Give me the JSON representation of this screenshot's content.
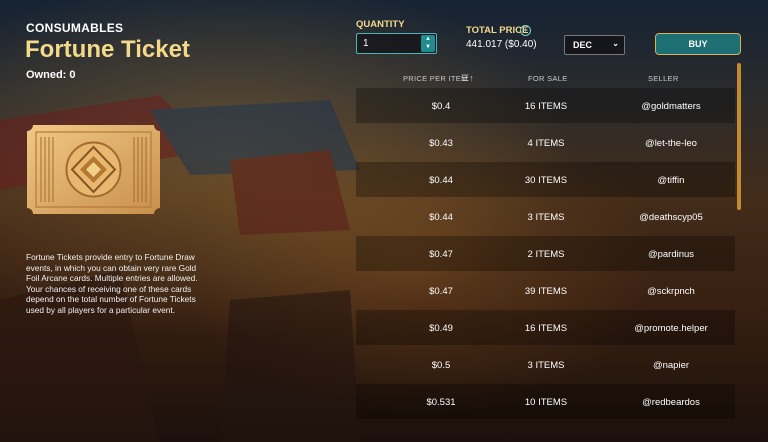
{
  "header": {
    "category": "CONSUMABLES",
    "title": "Fortune Ticket",
    "owned": "Owned: 0"
  },
  "description": "Fortune Tickets provide entry to Fortune Draw events, in which you can obtain very rare Gold Foil Arcane cards. Multiple entries are allowed. Your chances of receiving one of these cards depend on the total number of Fortune Tickets used by all players for a particular event.",
  "quantity": {
    "label": "QUANTITY",
    "value": "1"
  },
  "total_price": {
    "label": "TOTAL PRICE",
    "value": "441.017 ($0.40)"
  },
  "currency": {
    "selected": "DEC"
  },
  "buy_label": "BUY",
  "columns": {
    "price": "PRICE PER ITEM",
    "for_sale": "FOR SALE",
    "seller": "SELLER"
  },
  "listings": [
    {
      "price": "$0.4",
      "for_sale": "16 ITEMS",
      "seller": "@goldmatters"
    },
    {
      "price": "$0.43",
      "for_sale": "4 ITEMS",
      "seller": "@let-the-leo"
    },
    {
      "price": "$0.44",
      "for_sale": "30 ITEMS",
      "seller": "@tiffin"
    },
    {
      "price": "$0.44",
      "for_sale": "3 ITEMS",
      "seller": "@deathscyp05"
    },
    {
      "price": "$0.47",
      "for_sale": "2 ITEMS",
      "seller": "@pardinus"
    },
    {
      "price": "$0.47",
      "for_sale": "39 ITEMS",
      "seller": "@sckrpnch"
    },
    {
      "price": "$0.49",
      "for_sale": "16 ITEMS",
      "seller": "@promote.helper"
    },
    {
      "price": "$0.5",
      "for_sale": "3 ITEMS",
      "seller": "@napier"
    },
    {
      "price": "$0.531",
      "for_sale": "10 ITEMS",
      "seller": "@redbeardos"
    }
  ],
  "colors": {
    "gold": "#f4d98a",
    "teal": "#1d6f72",
    "scroll": "#c58a2e"
  }
}
